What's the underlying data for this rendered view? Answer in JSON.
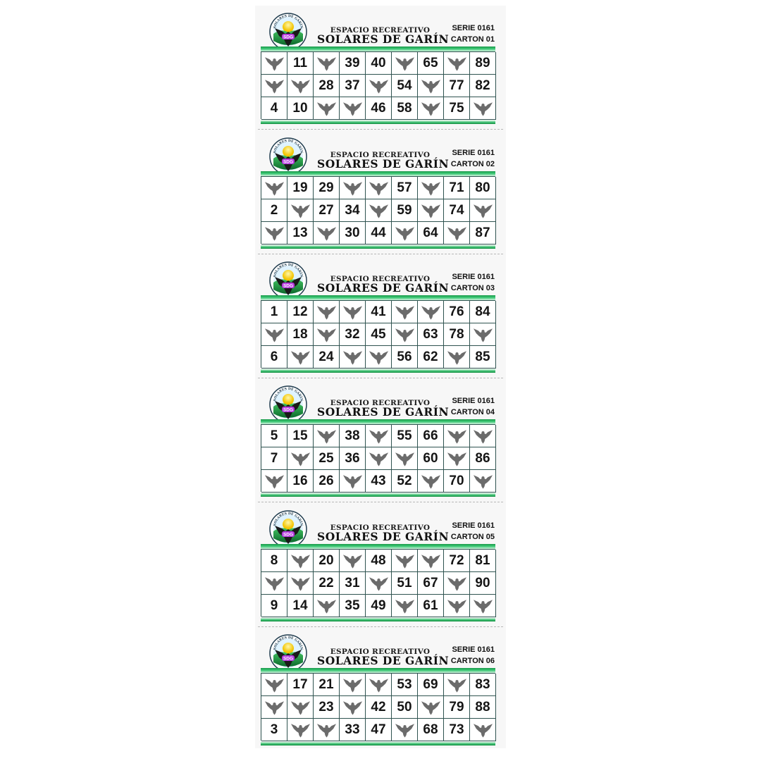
{
  "header": {
    "title_small": "ESPACIO RECREATIVO",
    "title_big": "SOLARES DE GARÍN",
    "serie": "SERIE 0161",
    "logo_text": "SOLARES DE GARÍN",
    "logo_initials": "SDG"
  },
  "icons": {
    "blank_cell": "eagle-icon",
    "logo": "sdg-logo-icon"
  },
  "colors": {
    "band_green": "#2bb866",
    "grid_border": "#2f5350",
    "eagle_gray": "#6b6b6b"
  },
  "cards": [
    {
      "carton": "CARTON 01",
      "rows": [
        [
          "",
          "11",
          "",
          "39",
          "40",
          "",
          "65",
          "",
          "89"
        ],
        [
          "",
          "",
          "28",
          "37",
          "",
          "54",
          "",
          "77",
          "82"
        ],
        [
          "4",
          "10",
          "",
          "",
          "46",
          "58",
          "",
          "75",
          ""
        ]
      ]
    },
    {
      "carton": "CARTON 02",
      "rows": [
        [
          "",
          "19",
          "29",
          "",
          "",
          "57",
          "",
          "71",
          "80"
        ],
        [
          "2",
          "",
          "27",
          "34",
          "",
          "59",
          "",
          "74",
          ""
        ],
        [
          "",
          "13",
          "",
          "30",
          "44",
          "",
          "64",
          "",
          "87"
        ]
      ]
    },
    {
      "carton": "CARTON 03",
      "rows": [
        [
          "1",
          "12",
          "",
          "",
          "41",
          "",
          "",
          "76",
          "84"
        ],
        [
          "",
          "18",
          "",
          "32",
          "45",
          "",
          "63",
          "78",
          ""
        ],
        [
          "6",
          "",
          "24",
          "",
          "",
          "56",
          "62",
          "",
          "85"
        ]
      ]
    },
    {
      "carton": "CARTON 04",
      "rows": [
        [
          "5",
          "15",
          "",
          "38",
          "",
          "55",
          "66",
          "",
          ""
        ],
        [
          "7",
          "",
          "25",
          "36",
          "",
          "",
          "60",
          "",
          "86"
        ],
        [
          "",
          "16",
          "26",
          "",
          "43",
          "52",
          "",
          "70",
          ""
        ]
      ]
    },
    {
      "carton": "CARTON 05",
      "rows": [
        [
          "8",
          "",
          "20",
          "",
          "48",
          "",
          "",
          "72",
          "81"
        ],
        [
          "",
          "",
          "22",
          "31",
          "",
          "51",
          "67",
          "",
          "90"
        ],
        [
          "9",
          "14",
          "",
          "35",
          "49",
          "",
          "61",
          "",
          ""
        ]
      ]
    },
    {
      "carton": "CARTON 06",
      "rows": [
        [
          "",
          "17",
          "21",
          "",
          "",
          "53",
          "69",
          "",
          "83"
        ],
        [
          "",
          "",
          "23",
          "",
          "42",
          "50",
          "",
          "79",
          "88"
        ],
        [
          "3",
          "",
          "",
          "33",
          "47",
          "",
          "68",
          "73",
          ""
        ]
      ]
    }
  ]
}
